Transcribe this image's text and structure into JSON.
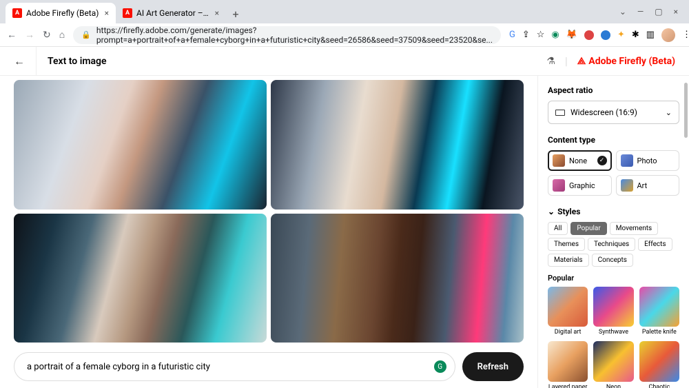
{
  "browser": {
    "tabs": [
      {
        "title": "Adobe Firefly (Beta)"
      },
      {
        "title": "AI Art Generator – Adobe Firefly"
      }
    ],
    "url": "https://firefly.adobe.com/generate/images?prompt=a+portrait+of+a+female+cyborg+in+a+futuristic+city&seed=26586&seed=37509&seed=23520&se..."
  },
  "header": {
    "title": "Text to image",
    "brand": "Adobe Firefly (Beta)"
  },
  "prompt": {
    "text": "a portrait of a female cyborg in a futuristic city",
    "refresh_label": "Refresh"
  },
  "sidebar": {
    "aspect_ratio": {
      "title": "Aspect ratio",
      "value": "Widescreen (16:9)"
    },
    "content_type": {
      "title": "Content type",
      "options": [
        {
          "label": "None",
          "selected": true,
          "bg": "linear-gradient(135deg,#e8a060,#8a4a30)"
        },
        {
          "label": "Photo",
          "selected": false,
          "bg": "linear-gradient(135deg,#6a8ad8,#3a5ab0)"
        },
        {
          "label": "Graphic",
          "selected": false,
          "bg": "linear-gradient(135deg,#d86aa8,#a03a78)"
        },
        {
          "label": "Art",
          "selected": false,
          "bg": "linear-gradient(135deg,#4a8ae0,#d8a030)"
        }
      ]
    },
    "styles": {
      "title": "Styles",
      "tabs": [
        "All",
        "Popular",
        "Movements",
        "Themes",
        "Techniques",
        "Effects",
        "Materials",
        "Concepts"
      ],
      "active_tab": "Popular",
      "section_title": "Popular",
      "items": [
        {
          "label": "Digital art",
          "bg": "linear-gradient(135deg,#7ab8e8,#e8905a,#d85a3a)"
        },
        {
          "label": "Synthwave",
          "bg": "linear-gradient(135deg,#3a5ae8,#e84a8a,#f8d030)"
        },
        {
          "label": "Palette knife",
          "bg": "linear-gradient(135deg,#e84aa8,#4ad8e8,#f8a030)"
        },
        {
          "label": "Layered paper",
          "bg": "linear-gradient(135deg,#f8e8d0,#e8a060,#8a5030)"
        },
        {
          "label": "Neon",
          "bg": "linear-gradient(135deg,#1a2a60,#f8c030,#e85a8a)"
        },
        {
          "label": "Chaotic",
          "bg": "linear-gradient(135deg,#e8d030,#e85a3a,#3a8ae8)"
        }
      ]
    }
  }
}
